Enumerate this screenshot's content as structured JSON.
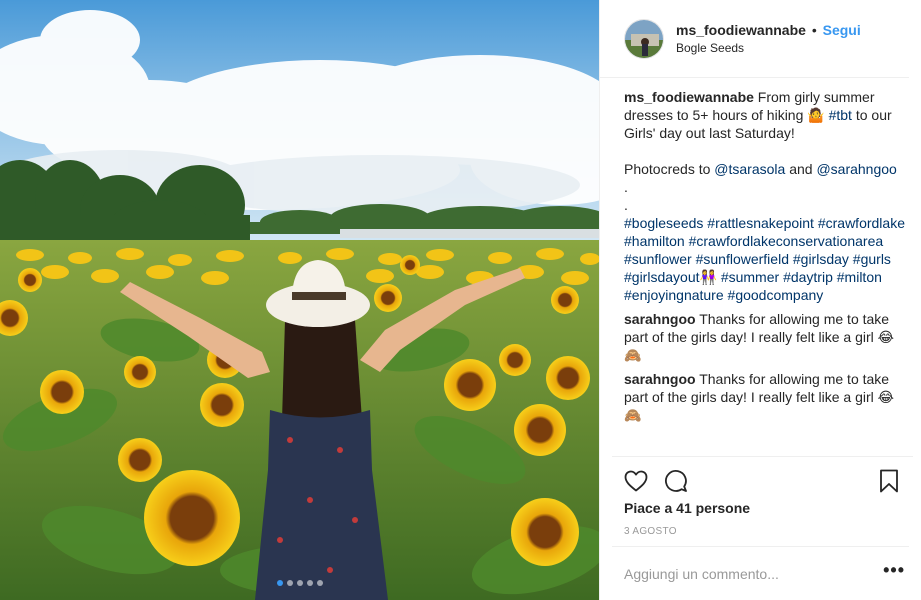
{
  "post": {
    "username": "ms_foodiewannabe",
    "separator": "•",
    "follow_label": "Segui",
    "location": "Bogle Seeds",
    "caption": {
      "username": "ms_foodiewannabe",
      "text_part1": " From girly summer dresses to 5+ hours of hiking 🤷 ",
      "tag_tbt": "#tbt",
      "text_part2": " to our Girls' day out last Saturday!\n\nPhotocreds to ",
      "mention1": "@tsarasola",
      "text_and": " and ",
      "mention2": "@sarahngoo",
      "dots": "\n.\n.\n",
      "hashtags": [
        "#bogleseeds",
        "#rattlesnakepoint",
        "#crawfordlake",
        "#hamilton",
        "#crawfordlakeconservationarea",
        "#sunflower",
        "#sunflowerfield",
        "#girlsday",
        "#gurls",
        "#girlsdayout👭",
        "#summer",
        "#daytrip",
        "#milton",
        "#enjoyingnature",
        "#goodcompany"
      ]
    },
    "comments": [
      {
        "username": "sarahngoo",
        "text": " Thanks for allowing me to take part of the girls day! I really felt like a girl 😂🙈"
      },
      {
        "username": "sarahngoo",
        "text": " Thanks for allowing me to take part of the girls day! I really felt like a girl 😂🙈"
      }
    ],
    "likes_text": "Piace a 41 persone",
    "date": "3 AGOSTO",
    "comment_placeholder": "Aggiungi un commento...",
    "more_label": "•••",
    "carousel": {
      "count": 5,
      "active": 0
    },
    "icons": {
      "like": "heart-icon",
      "comment": "comment-bubble-icon",
      "save": "bookmark-icon"
    },
    "colors": {
      "link": "#3897f0",
      "hashtag": "#003569",
      "border": "#efefef",
      "muted": "#999999"
    }
  }
}
